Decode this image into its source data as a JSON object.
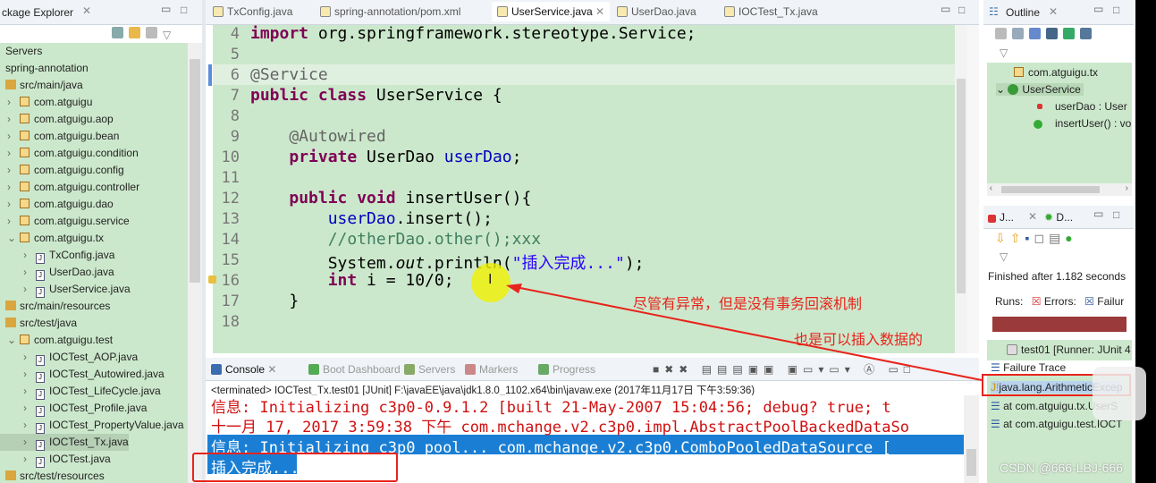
{
  "package_explorer": {
    "title": "ckage Explorer",
    "items": [
      {
        "label": "Servers",
        "indent": 0,
        "icon": "folder"
      },
      {
        "label": "spring-annotation",
        "indent": 0,
        "icon": "project"
      },
      {
        "label": "src/main/java",
        "indent": 0,
        "icon": "source-folder"
      },
      {
        "label": "com.atguigu",
        "indent": 1,
        "icon": "package"
      },
      {
        "label": "com.atguigu.aop",
        "indent": 1,
        "icon": "package"
      },
      {
        "label": "com.atguigu.bean",
        "indent": 1,
        "icon": "package"
      },
      {
        "label": "com.atguigu.condition",
        "indent": 1,
        "icon": "package"
      },
      {
        "label": "com.atguigu.config",
        "indent": 1,
        "icon": "package"
      },
      {
        "label": "com.atguigu.controller",
        "indent": 1,
        "icon": "package"
      },
      {
        "label": "com.atguigu.dao",
        "indent": 1,
        "icon": "package"
      },
      {
        "label": "com.atguigu.service",
        "indent": 1,
        "icon": "package"
      },
      {
        "label": "com.atguigu.tx",
        "indent": 1,
        "icon": "package",
        "expanded": true
      },
      {
        "label": "TxConfig.java",
        "indent": 2,
        "icon": "java-file"
      },
      {
        "label": "UserDao.java",
        "indent": 2,
        "icon": "java-file"
      },
      {
        "label": "UserService.java",
        "indent": 2,
        "icon": "java-file"
      },
      {
        "label": "src/main/resources",
        "indent": 0,
        "icon": "source-folder"
      },
      {
        "label": "src/test/java",
        "indent": 0,
        "icon": "source-folder"
      },
      {
        "label": "com.atguigu.test",
        "indent": 1,
        "icon": "package",
        "expanded": true
      },
      {
        "label": "IOCTest_AOP.java",
        "indent": 2,
        "icon": "java-file"
      },
      {
        "label": "IOCTest_Autowired.java",
        "indent": 2,
        "icon": "java-file"
      },
      {
        "label": "IOCTest_LifeCycle.java",
        "indent": 2,
        "icon": "java-file"
      },
      {
        "label": "IOCTest_Profile.java",
        "indent": 2,
        "icon": "java-file"
      },
      {
        "label": "IOCTest_PropertyValue.java",
        "indent": 2,
        "icon": "java-file"
      },
      {
        "label": "IOCTest_Tx.java",
        "indent": 2,
        "icon": "java-file",
        "selected": true
      },
      {
        "label": "IOCTest.java",
        "indent": 2,
        "icon": "java-file"
      },
      {
        "label": "src/test/resources",
        "indent": 0,
        "icon": "source-folder"
      }
    ]
  },
  "editor": {
    "tabs": [
      {
        "label": "TxConfig.java"
      },
      {
        "label": "spring-annotation/pom.xml"
      },
      {
        "label": "UserService.java",
        "active": true
      },
      {
        "label": "UserDao.java"
      },
      {
        "label": "IOCTest_Tx.java"
      }
    ],
    "line_numbers": [
      "4",
      "5",
      "6",
      "7",
      "8",
      "9",
      "10",
      "11",
      "12",
      "13",
      "14",
      "15",
      "16",
      "17",
      "18"
    ]
  },
  "console": {
    "tabs": [
      "Console",
      "Boot Dashboard",
      "Servers",
      "Markers",
      "Progress"
    ],
    "status": "<terminated> IOCTest_Tx.test01 [JUnit] F:\\javaEE\\java\\jdk1.8.0_1102.x64\\bin\\javaw.exe (2017年11月17日 下午3:59:36)",
    "lines": [
      "信息: Initializing c3p0-0.9.1.2 [built 21-May-2007 15:04:56; debug? true; t",
      "十一月 17, 2017 3:59:38 下午 com.mchange.v2.c3p0.impl.AbstractPoolBackedDataSo",
      "信息: Initializing c3p0 pool... com.mchange.v2.c3p0.ComboPooledDataSource [",
      "插入完成..."
    ]
  },
  "outline": {
    "title": "Outline",
    "items": [
      "com.atguigu.tx",
      "UserService",
      "userDao : User",
      "insertUser() : vo"
    ]
  },
  "junit": {
    "tab1": "J...",
    "tab2": "D...",
    "finished": "Finished after 1.182 seconds",
    "runs": "Runs:",
    "errors": "Errors:",
    "failures": "Failur",
    "bar_color": "#9b3a3a",
    "test": "test01 [Runner: JUnit 4",
    "failure_trace": "Failure Trace",
    "trace": [
      "java.lang.ArithmeticExcep",
      "at com.atguigu.tx.UserS",
      "at com.atguigu.test.IOCT"
    ]
  },
  "annotations": {
    "note1": "尽管有异常，但是没有事务回滚机制",
    "note2": "也是可以插入数据的",
    "color": "#e8231b"
  },
  "watermark": "CSDN @666-LBJ-666"
}
